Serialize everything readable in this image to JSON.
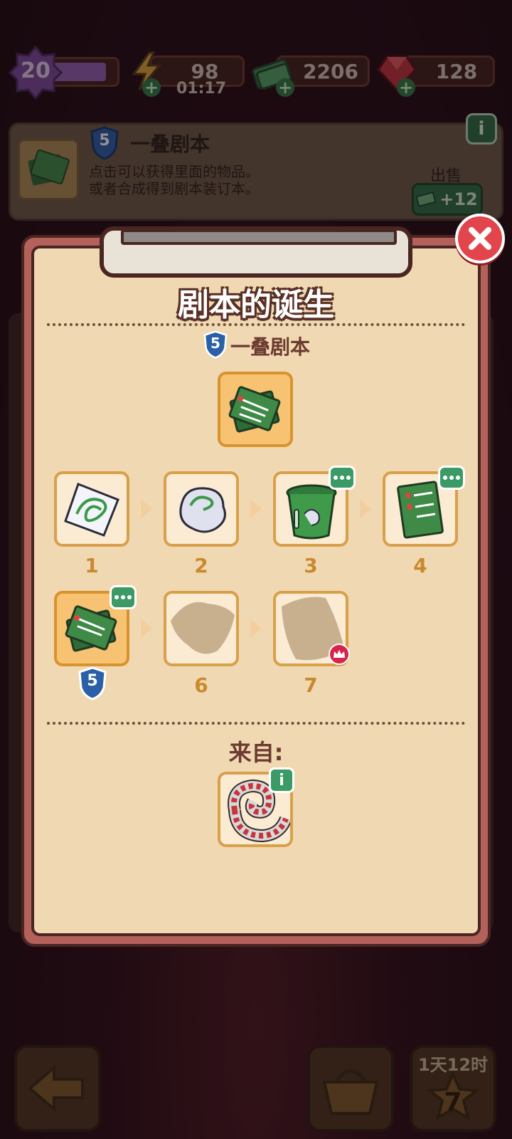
{
  "topbar": {
    "level": "20",
    "level_progress": 0.85,
    "energy": "98",
    "energy_timer": "01:17",
    "cash": "2206",
    "gems": "128"
  },
  "info_panel": {
    "item_level": "5",
    "item_name": "一叠剧本",
    "desc_line1": "点击可以获得里面的物品。",
    "desc_line2": "或者合成得到剧本装订本。",
    "sell_label": "出售",
    "sell_price": "+12"
  },
  "dialog": {
    "title": "剧本的诞生",
    "item_level": "5",
    "item_name": "一叠剧本",
    "chain": [
      {
        "num": "1",
        "icon": "scribbled-paper-icon"
      },
      {
        "num": "2",
        "icon": "crumpled-paper-icon"
      },
      {
        "num": "3",
        "icon": "trash-can-icon"
      },
      {
        "num": "4",
        "icon": "script-page-icon"
      },
      {
        "num": "5",
        "icon": "script-stack-icon"
      },
      {
        "num": "6",
        "icon": "locked-silhouette-icon"
      },
      {
        "num": "7",
        "icon": "locked-silhouette-icon"
      }
    ],
    "current_level_badge": "5",
    "from_label": "来自:",
    "source_icon": "film-reel-icon"
  },
  "bottom": {
    "timer": "1天12时",
    "star_count": "7"
  },
  "colors": {
    "accent_green": "#3c9a66",
    "close_red": "#e2454c",
    "tile_border": "#d9a04b",
    "paper": "#f0d9b2"
  }
}
